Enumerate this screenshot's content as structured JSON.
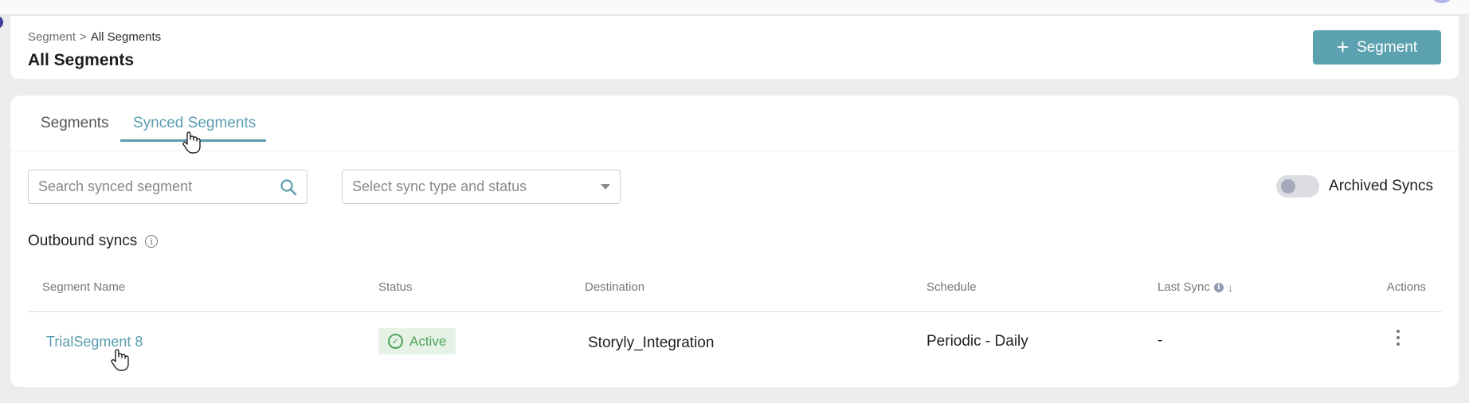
{
  "header": {
    "breadcrumb_parent": "Segment",
    "breadcrumb_separator": ">",
    "breadcrumb_current": "All Segments",
    "title": "All Segments",
    "add_button_label": "Segment"
  },
  "tabs": [
    {
      "label": "Segments",
      "active": false
    },
    {
      "label": "Synced Segments",
      "active": true
    }
  ],
  "filters": {
    "search_placeholder": "Search synced segment",
    "select_placeholder": "Select sync type and status",
    "archived_label": "Archived Syncs",
    "archived_enabled": false
  },
  "section": {
    "title": "Outbound syncs"
  },
  "table": {
    "columns": {
      "name": "Segment Name",
      "status": "Status",
      "destination": "Destination",
      "schedule": "Schedule",
      "last_sync": "Last Sync",
      "actions": "Actions"
    },
    "rows": [
      {
        "name": "TrialSegment 8",
        "status": "Active",
        "destination": "Storyly_Integration",
        "schedule": "Periodic - Daily",
        "last_sync": "-"
      }
    ]
  },
  "colors": {
    "accent": "#5b9db0",
    "button": "#5ba1b0",
    "status_active": "#4fa55c",
    "status_active_bg": "#e6f2e6"
  },
  "icons": [
    "plus-icon",
    "search-icon",
    "chevron-down-icon",
    "info-icon",
    "sort-down-icon",
    "check-circle-icon",
    "kebab-menu-icon",
    "hand-cursor-icon"
  ]
}
